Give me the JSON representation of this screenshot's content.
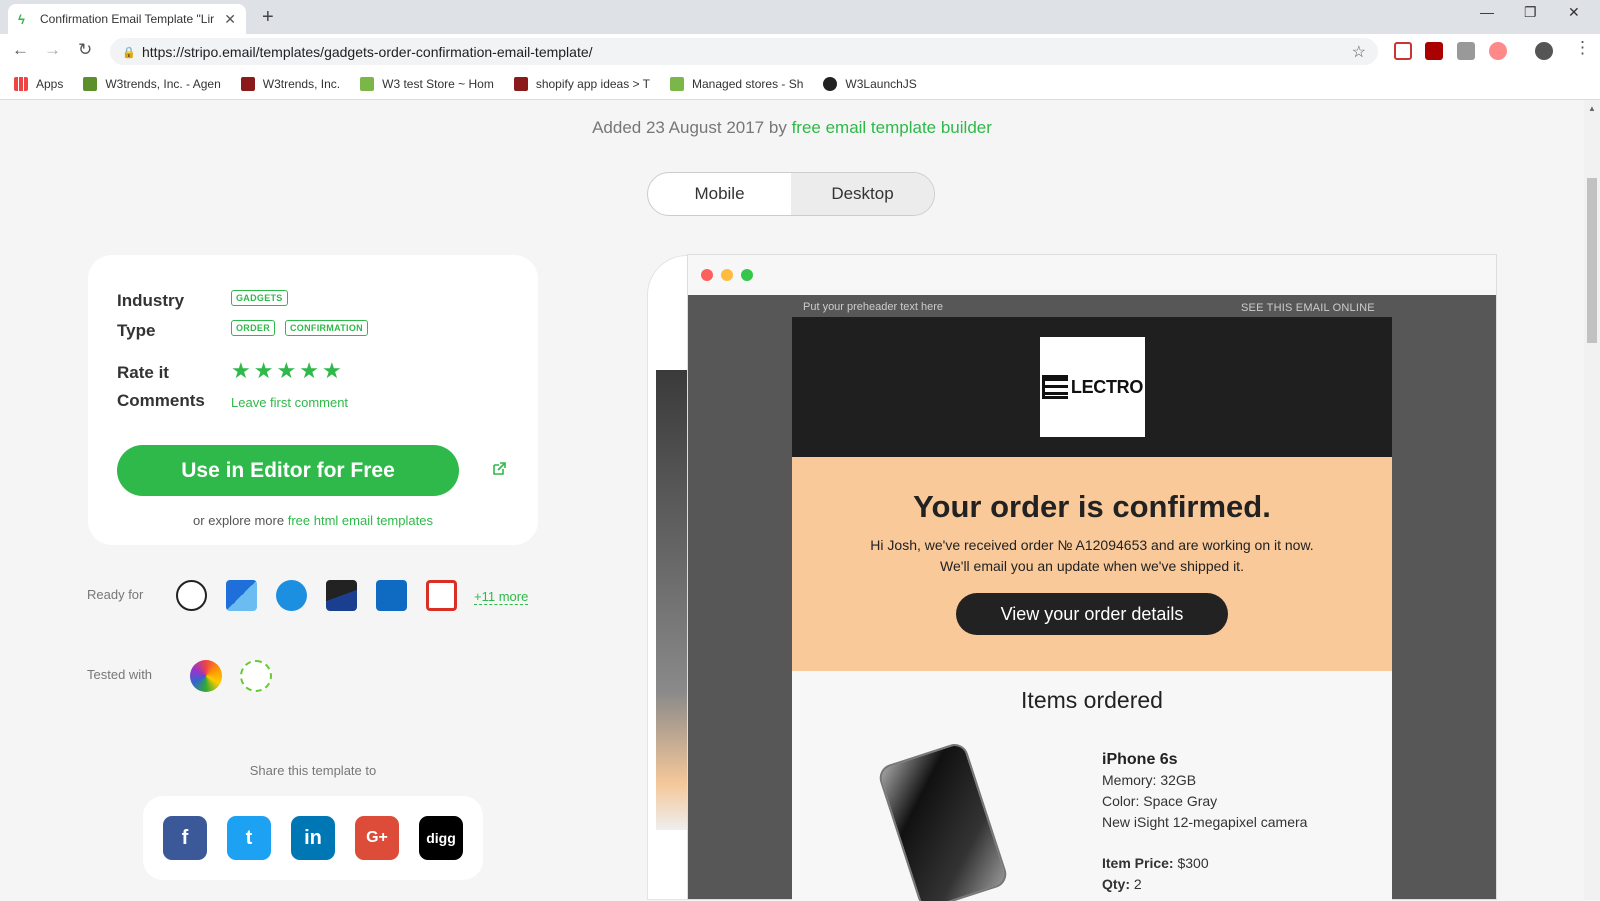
{
  "browser": {
    "tab_title": "Confirmation Email Template \"Lir",
    "url": "https://stripo.email/templates/gadgets-order-confirmation-email-template/",
    "bookmarks": [
      "Apps",
      "W3trends, Inc. - Agen",
      "W3trends, Inc.",
      "W3 test Store ~ Hom",
      "shopify app ideas > T",
      "Managed stores - Sh",
      "W3LaunchJS"
    ]
  },
  "page": {
    "added_text": "Added 23 August 2017 by",
    "added_link": "free email template builder",
    "view_toggle": {
      "mobile": "Mobile",
      "desktop": "Desktop",
      "selected": "Desktop"
    }
  },
  "info": {
    "industry_label": "Industry",
    "industry_tag": "GADGETS",
    "type_label": "Type",
    "type_tags": [
      "ORDER",
      "CONFIRMATION"
    ],
    "rate_label": "Rate it",
    "rating": 5,
    "comments_label": "Comments",
    "comments_link": "Leave first comment",
    "use_button": "Use in Editor for Free",
    "explore_prefix": "or explore more",
    "explore_link": "free html email templates"
  },
  "ready": {
    "label": "Ready for",
    "more": "+11 more"
  },
  "tested": {
    "label": "Tested with"
  },
  "share": {
    "label": "Share this template to"
  },
  "email": {
    "preheader": "Put your preheader text here",
    "online": "SEE THIS EMAIL ONLINE",
    "logo_text": "LECTRO",
    "heading": "Your order is confirmed.",
    "body_line1": "Hi Josh, we've received order № A12094653 and are working on it now.",
    "body_line2": "We'll email you an update when we've shipped it.",
    "button": "View your order details",
    "items_title": "Items ordered",
    "product": {
      "name": "iPhone 6s",
      "memory": "Memory: 32GB",
      "color": "Color: Space Gray",
      "feature": "New iSight 12-megapixel camera",
      "price_label": "Item Price:",
      "price": "$300",
      "qty_label": "Qty:",
      "qty": "2"
    }
  },
  "colors": {
    "accent": "#2fb94a",
    "email_header": "#1f1f1f",
    "email_confirm_bg": "#f9c999"
  }
}
